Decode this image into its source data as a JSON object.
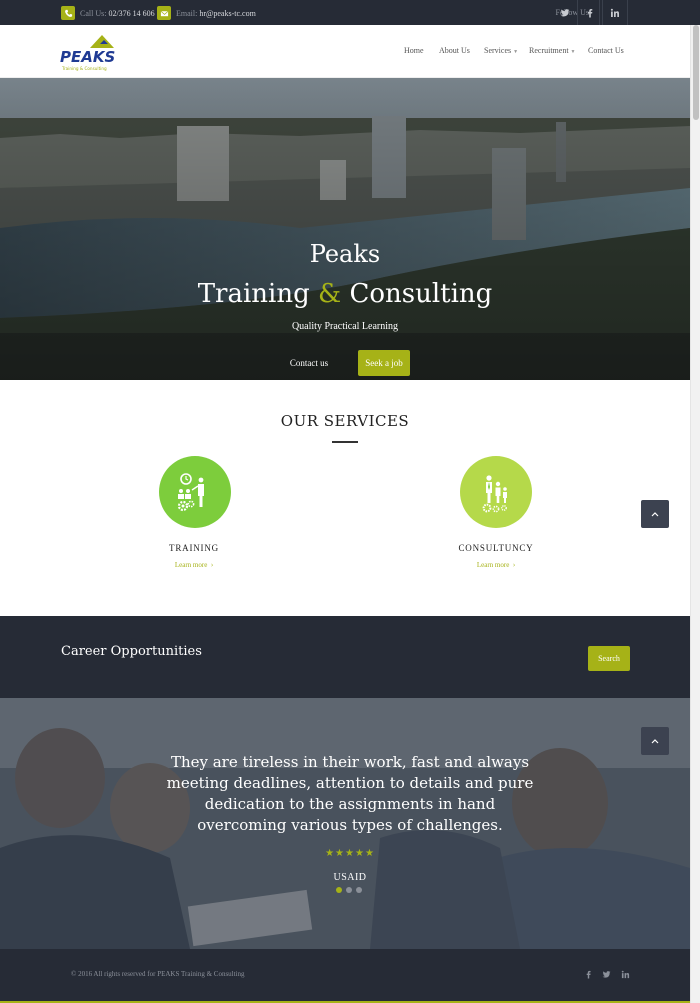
{
  "topbar": {
    "phone_label": "Call Us:",
    "phone_value": "02/376 14 606",
    "email_label": "Email:",
    "email_value": "hr@peaks-tc.com",
    "follow_label": "Follow Us",
    "social_icons": [
      "twitter-icon",
      "facebook-icon",
      "linkedin-icon"
    ]
  },
  "header": {
    "logo_text": "PEAKS",
    "logo_tagline": "Training & Consulting",
    "nav": [
      {
        "label": "Home",
        "has_dropdown": false
      },
      {
        "label": "About Us",
        "has_dropdown": false
      },
      {
        "label": "Services",
        "has_dropdown": true
      },
      {
        "label": "Recruitment",
        "has_dropdown": true
      },
      {
        "label": "Contact Us",
        "has_dropdown": false
      }
    ]
  },
  "hero": {
    "title_line1": "Peaks",
    "title_word1": "Training",
    "title_amp": "&",
    "title_word2": "Consulting",
    "subtitle": "Quality Practical Learning",
    "contact_button": "Contact us",
    "seek_button": "Seek a job"
  },
  "services": {
    "title": "OUR SERVICES",
    "items": [
      {
        "name": "TRAINING",
        "link": "Learn more",
        "icon": "training-icon"
      },
      {
        "name": "CONSULTUNCY",
        "link": "Learn more",
        "icon": "consultancy-icon"
      }
    ]
  },
  "career": {
    "title": "Career Opportunities",
    "search_button": "Search"
  },
  "testimonial": {
    "quote": "They are tireless in their work, fast and always meeting deadlines, attention to details and pure dedication to the assignments in hand overcoming various types of challenges.",
    "stars": "★★★★★",
    "rating": 5,
    "author": "USAID",
    "slides_total": 3,
    "active_slide": 1
  },
  "footer": {
    "copyright": "© 2016 All rights reserved for PEAKS Training & Consulting",
    "social_icons": [
      "facebook-icon",
      "twitter-icon",
      "linkedin-icon"
    ]
  },
  "colors": {
    "accent": "#a6b217",
    "dark": "#262b36",
    "light_green": "#b5d94a",
    "green": "#7dcd3c"
  }
}
